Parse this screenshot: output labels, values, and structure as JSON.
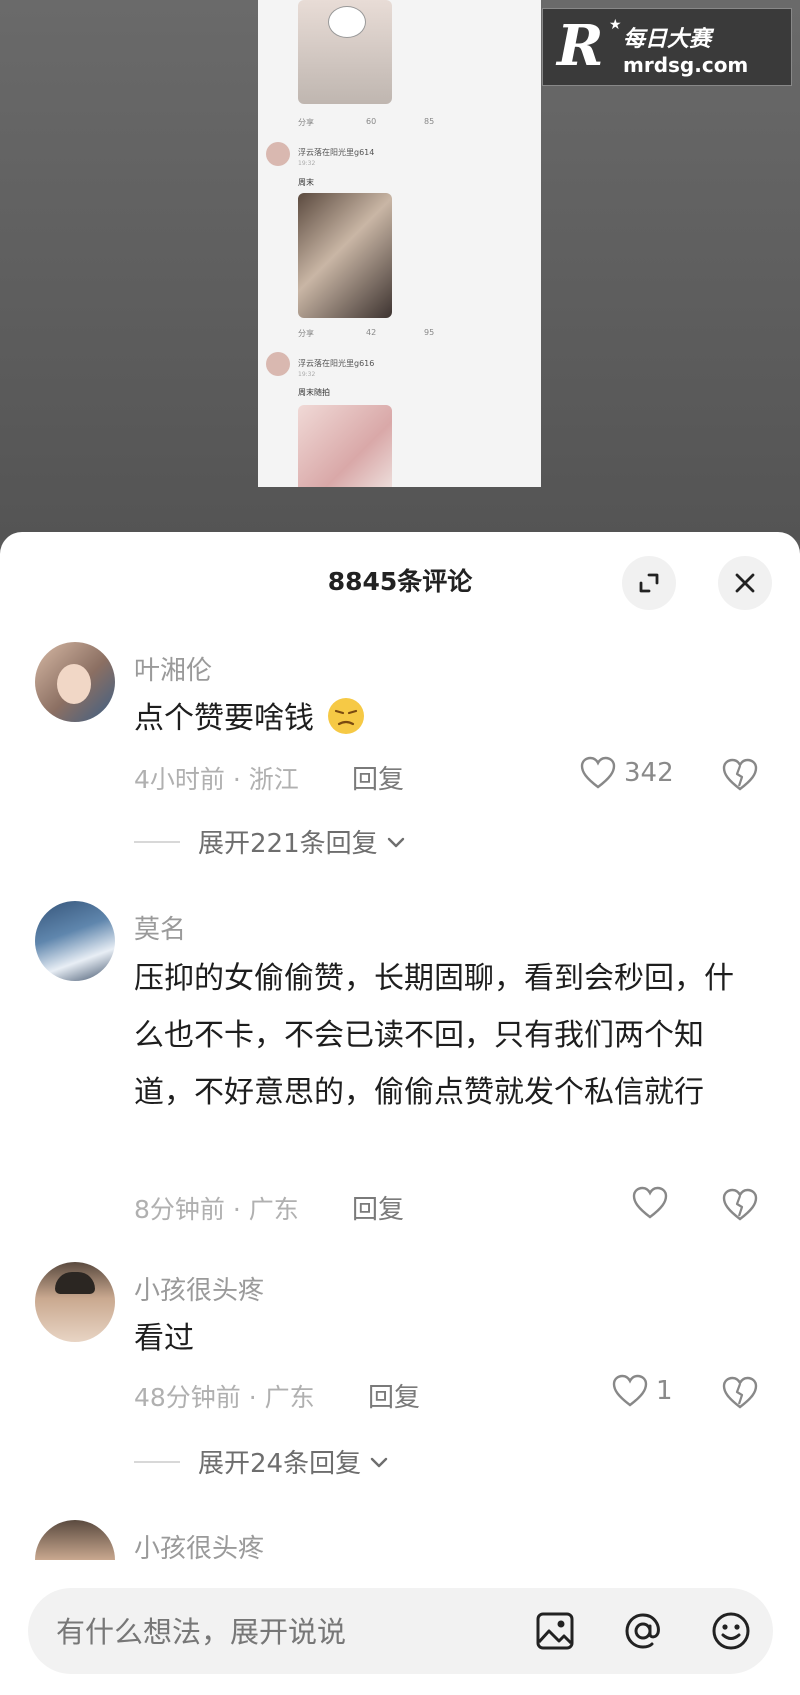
{
  "watermark": {
    "cn": "每日大赛",
    "domain": "mrdsg.com",
    "logo": "R"
  },
  "embedded_screenshot": {
    "posts": [
      {
        "share": "分享",
        "comments": "60",
        "likes": "85"
      },
      {
        "user": "浮云落在阳光里g614",
        "time": "19:32",
        "caption": "周末",
        "share": "分享",
        "comments": "42",
        "likes": "95"
      },
      {
        "user": "浮云落在阳光里g616",
        "time": "19:32",
        "caption": "周末随拍"
      }
    ]
  },
  "sheet": {
    "title": "8845条评论"
  },
  "comments": [
    {
      "author": "叶湘伦",
      "text": "点个赞要啥钱",
      "meta": "4小时前 · 浙江",
      "reply": "回复",
      "likes": "342",
      "expand": "展开221条回复"
    },
    {
      "author": "莫名",
      "text": "压抑的女偷偷赞，长期固聊，看到会秒回，什么也不卡，不会已读不回，只有我们两个知道，不好意思的，偷偷点赞就发个私信就行",
      "meta": "8分钟前 · 广东",
      "reply": "回复",
      "likes": ""
    },
    {
      "author": "小孩很头疼",
      "text": "看过",
      "meta": "48分钟前 · 广东",
      "reply": "回复",
      "likes": "1",
      "expand": "展开24条回复"
    },
    {
      "author": "小孩很头疼"
    }
  ],
  "input": {
    "placeholder": "有什么想法，展开说说"
  },
  "icons": {
    "expand": "expand-icon",
    "close": "close-icon",
    "image": "image-icon",
    "at": "at-icon",
    "emoji": "emoji-icon"
  }
}
